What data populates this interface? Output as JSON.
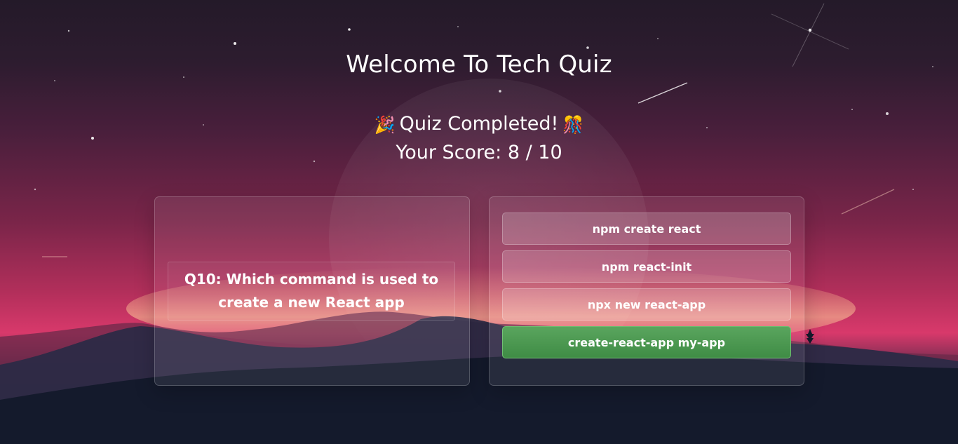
{
  "header": {
    "title": "Welcome To Tech Quiz"
  },
  "result": {
    "completed_text": "Quiz Completed!",
    "emoji_left": "🎉",
    "emoji_right": "🎊",
    "score_text": "Your Score: 8 / 10"
  },
  "question": {
    "number_label": "Q10:",
    "text": "Which command is used to create a new React app"
  },
  "options": [
    {
      "label": "npm create react",
      "state": "default"
    },
    {
      "label": "npm react-init",
      "state": "default"
    },
    {
      "label": "npx new react-app",
      "state": "default"
    },
    {
      "label": "create-react-app my-app",
      "state": "correct"
    }
  ],
  "colors": {
    "correct": "#4a9a50",
    "text": "#ffffff",
    "sky_top": "#241a29",
    "sky_glow": "#d8396b",
    "ground": "#131a2c"
  }
}
